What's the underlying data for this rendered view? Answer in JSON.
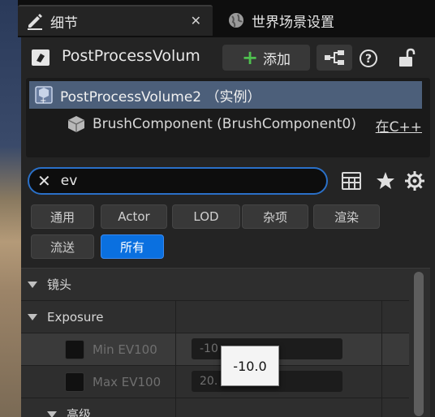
{
  "tabs": [
    {
      "label": "细节",
      "icon": "details-pencil-icon",
      "active": true
    },
    {
      "label": "世界场景设置",
      "icon": "world-globe-icon",
      "active": false
    }
  ],
  "actor": {
    "name": "PostProcessVolum",
    "add_label": "添加",
    "icon": "actor-cube-icon"
  },
  "components": [
    {
      "label": "PostProcessVolume2 （实例）",
      "icon": "volume-icon",
      "selected": true
    },
    {
      "label": "BrushComponent (BrushComponent0)",
      "icon": "brush-cube-icon",
      "source": "在C++",
      "selected": false
    }
  ],
  "search": {
    "value": "ev"
  },
  "filters": [
    {
      "label": "通用",
      "active": false
    },
    {
      "label": "Actor",
      "active": false
    },
    {
      "label": "LOD",
      "active": false
    },
    {
      "label": "杂项",
      "active": false
    },
    {
      "label": "渲染",
      "active": false
    },
    {
      "label": "流送",
      "active": false
    },
    {
      "label": "所有",
      "active": true
    }
  ],
  "categories": {
    "lens": "镜头",
    "exposure": "Exposure",
    "advanced": "高级"
  },
  "properties": [
    {
      "name": "Min EV100",
      "value": "-10",
      "enabled": false
    },
    {
      "name": "Max EV100",
      "value": "20.",
      "enabled": false
    }
  ],
  "tooltip": {
    "text": "-10.0"
  },
  "colors": {
    "accent": "#0a70e0",
    "search_border": "#2a70c8",
    "selection": "#4c5f7a",
    "add_plus": "#4fc04f"
  }
}
